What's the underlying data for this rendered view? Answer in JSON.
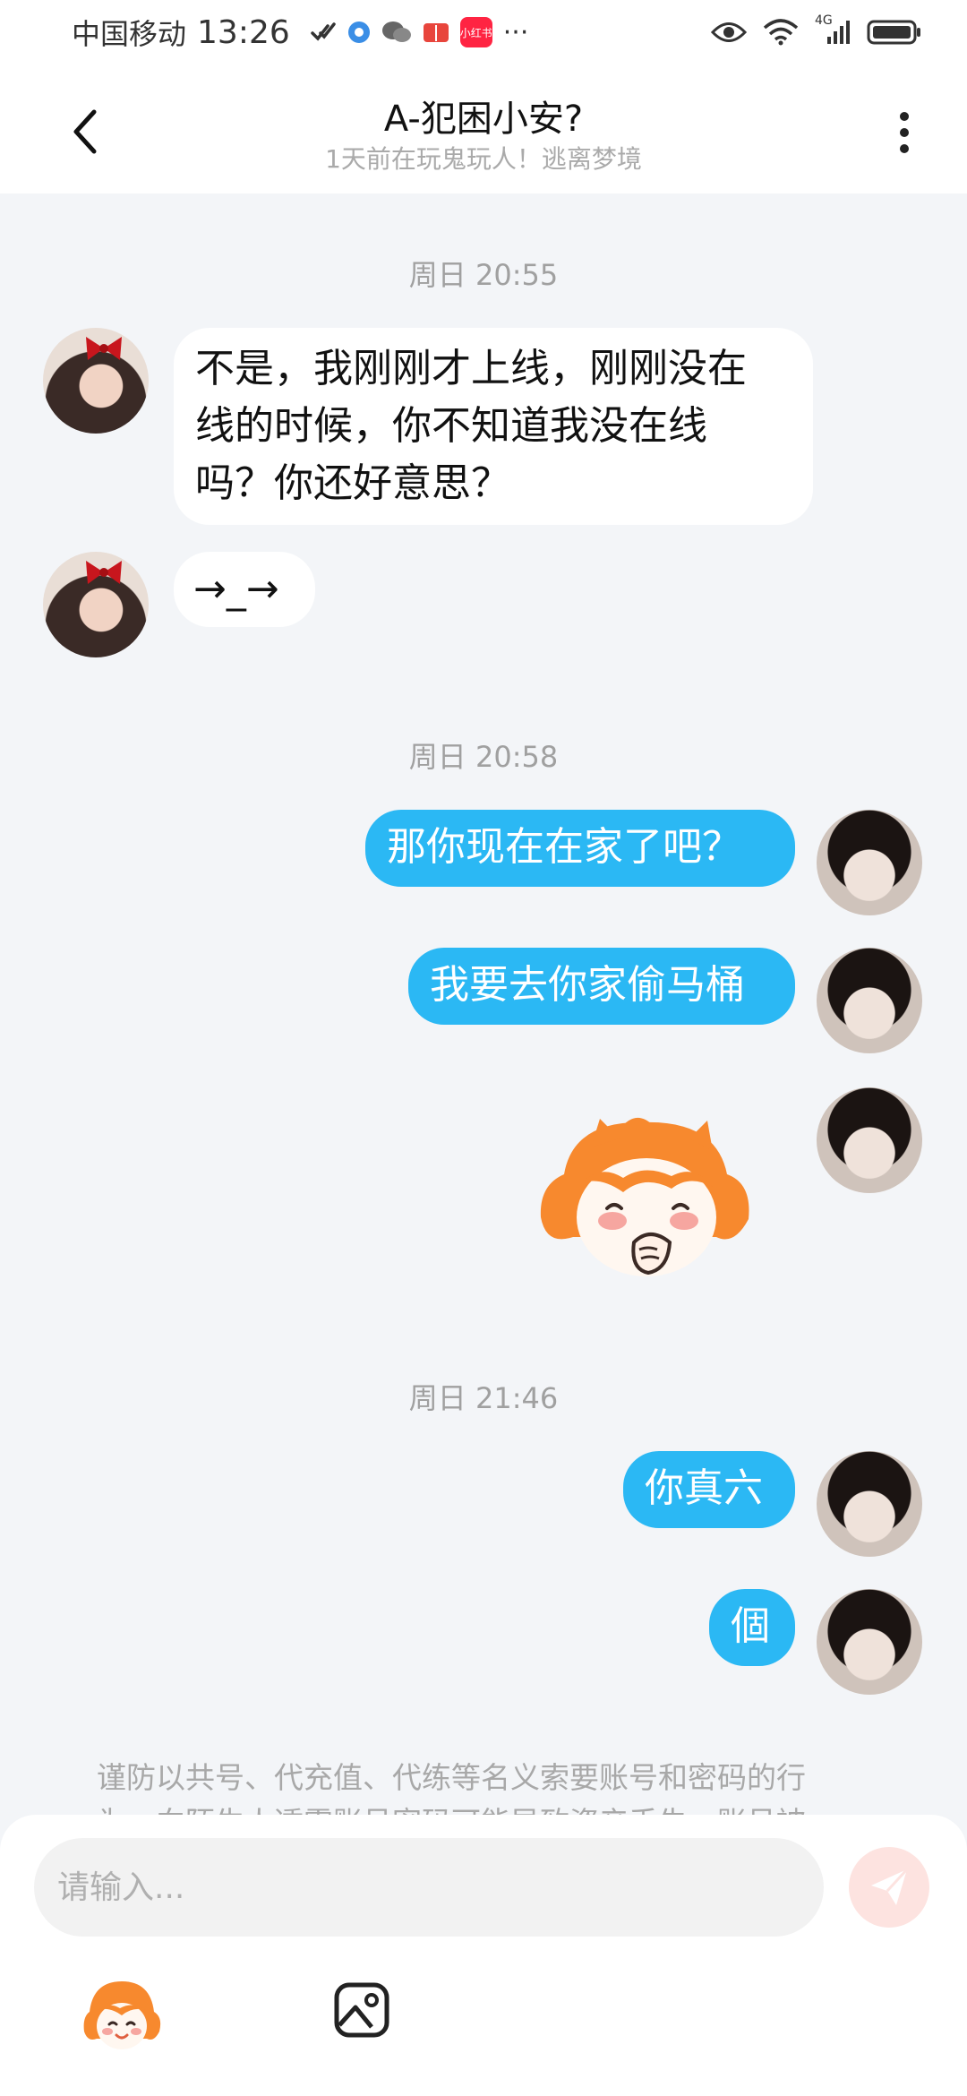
{
  "status_bar": {
    "carrier": "中国移动",
    "time": "13:26",
    "app_badge": "小红书",
    "more_dots": "···",
    "network": "4G"
  },
  "header": {
    "title": "A-犯困小安?",
    "subtitle": "1天前在玩鬼玩人！逃离梦境"
  },
  "chat": {
    "timestamps": [
      "周日 20:55",
      "周日 20:58",
      "周日 21:46"
    ],
    "messages": [
      {
        "side": "left",
        "lines": [
          "不是，我刚刚才上线，刚刚没在",
          "线的时候，你不知道我没在线",
          "吗？你还好意思？"
        ]
      },
      {
        "side": "left",
        "text": "→_→"
      },
      {
        "side": "right",
        "text": "那你现在在家了吧？"
      },
      {
        "side": "right",
        "text": "我要去你家偷马桶"
      },
      {
        "side": "right",
        "sticker": "laughing-girl-sticker"
      },
      {
        "side": "right",
        "text": "你真六"
      },
      {
        "side": "right",
        "text": "個"
      }
    ]
  },
  "notice": {
    "line1": "谨防以共号、代充值、代练等名义索要账号和密码的行",
    "line2": "为，向陌生人透露账号密码可能导致资产丢失，账号被"
  },
  "input": {
    "placeholder": "请输入..."
  },
  "colors": {
    "accent_blue": "#2bb8f4",
    "background": "#f3f5f8",
    "send_button": "#fde3e0",
    "sticker_orange": "#f7892e"
  }
}
